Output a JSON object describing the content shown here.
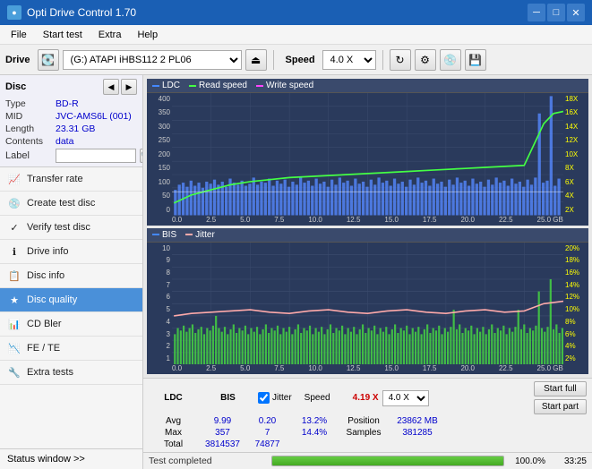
{
  "app": {
    "title": "Opti Drive Control 1.70",
    "icon": "●"
  },
  "titlebar": {
    "minimize": "─",
    "maximize": "□",
    "close": "✕"
  },
  "menubar": {
    "items": [
      "File",
      "Start test",
      "Extra",
      "Help"
    ]
  },
  "toolbar": {
    "drive_label": "Drive",
    "drive_value": "(G:)  ATAPI iHBS112  2 PL06",
    "speed_label": "Speed",
    "speed_value": "4.0 X"
  },
  "disc": {
    "title": "Disc",
    "type_label": "Type",
    "type_value": "BD-R",
    "mid_label": "MID",
    "mid_value": "JVC-AMS6L (001)",
    "length_label": "Length",
    "length_value": "23.31 GB",
    "contents_label": "Contents",
    "contents_value": "data",
    "label_label": "Label",
    "label_value": ""
  },
  "sidebar": {
    "items": [
      {
        "id": "transfer-rate",
        "label": "Transfer rate",
        "icon": "📈"
      },
      {
        "id": "create-test-disc",
        "label": "Create test disc",
        "icon": "💿"
      },
      {
        "id": "verify-test-disc",
        "label": "Verify test disc",
        "icon": "✓"
      },
      {
        "id": "drive-info",
        "label": "Drive info",
        "icon": "ℹ"
      },
      {
        "id": "disc-info",
        "label": "Disc info",
        "icon": "📋"
      },
      {
        "id": "disc-quality",
        "label": "Disc quality",
        "icon": "★",
        "active": true
      },
      {
        "id": "cd-bler",
        "label": "CD Bler",
        "icon": "📊"
      },
      {
        "id": "fe-te",
        "label": "FE / TE",
        "icon": "📉"
      },
      {
        "id": "extra-tests",
        "label": "Extra tests",
        "icon": "🔧"
      }
    ],
    "status_window": "Status window >>"
  },
  "chart": {
    "title": "Disc quality",
    "top": {
      "title": "",
      "legends": [
        {
          "id": "ldc",
          "label": "LDC",
          "color": "#5588ff"
        },
        {
          "id": "read",
          "label": "Read speed",
          "color": "#44ff44"
        },
        {
          "id": "write",
          "label": "Write speed",
          "color": "#ff88ff"
        }
      ],
      "y_left": [
        "400",
        "350",
        "300",
        "250",
        "200",
        "150",
        "100",
        "50",
        "0"
      ],
      "y_right": [
        "18X",
        "16X",
        "14X",
        "12X",
        "10X",
        "8X",
        "6X",
        "4X",
        "2X"
      ],
      "x_labels": [
        "0.0",
        "2.5",
        "5.0",
        "7.5",
        "10.0",
        "12.5",
        "15.0",
        "17.5",
        "20.0",
        "22.5",
        "25.0 GB"
      ]
    },
    "bottom": {
      "legends": [
        {
          "id": "bis",
          "label": "BIS",
          "color": "#5588ff"
        },
        {
          "id": "jitter",
          "label": "Jitter",
          "color": "#ffaaaa"
        }
      ],
      "y_left": [
        "10",
        "9",
        "8",
        "7",
        "6",
        "5",
        "4",
        "3",
        "2",
        "1"
      ],
      "y_right": [
        "20%",
        "18%",
        "16%",
        "14%",
        "12%",
        "10%",
        "8%",
        "6%",
        "4%",
        "2%"
      ],
      "x_labels": [
        "0.0",
        "2.5",
        "5.0",
        "7.5",
        "10.0",
        "12.5",
        "15.0",
        "17.5",
        "20.0",
        "22.5",
        "25.0 GB"
      ]
    }
  },
  "stats": {
    "headers": [
      "",
      "LDC",
      "BIS",
      "",
      "Jitter",
      "Speed",
      ""
    ],
    "avg_label": "Avg",
    "max_label": "Max",
    "total_label": "Total",
    "ldc_avg": "9.99",
    "ldc_max": "357",
    "ldc_total": "3814537",
    "bis_avg": "0.20",
    "bis_max": "7",
    "bis_total": "74877",
    "jitter_avg": "13.2%",
    "jitter_max": "14.4%",
    "jitter_total": "",
    "jitter_checked": true,
    "speed_label": "Speed",
    "speed_value": "4.19 X",
    "speed_select": "4.0 X",
    "position_label": "Position",
    "position_value": "23862 MB",
    "samples_label": "Samples",
    "samples_value": "381285",
    "start_full_label": "Start full",
    "start_part_label": "Start part"
  },
  "progressbar": {
    "status": "Test completed",
    "percent": 100,
    "percent_label": "100.0%",
    "time": "33:25"
  }
}
